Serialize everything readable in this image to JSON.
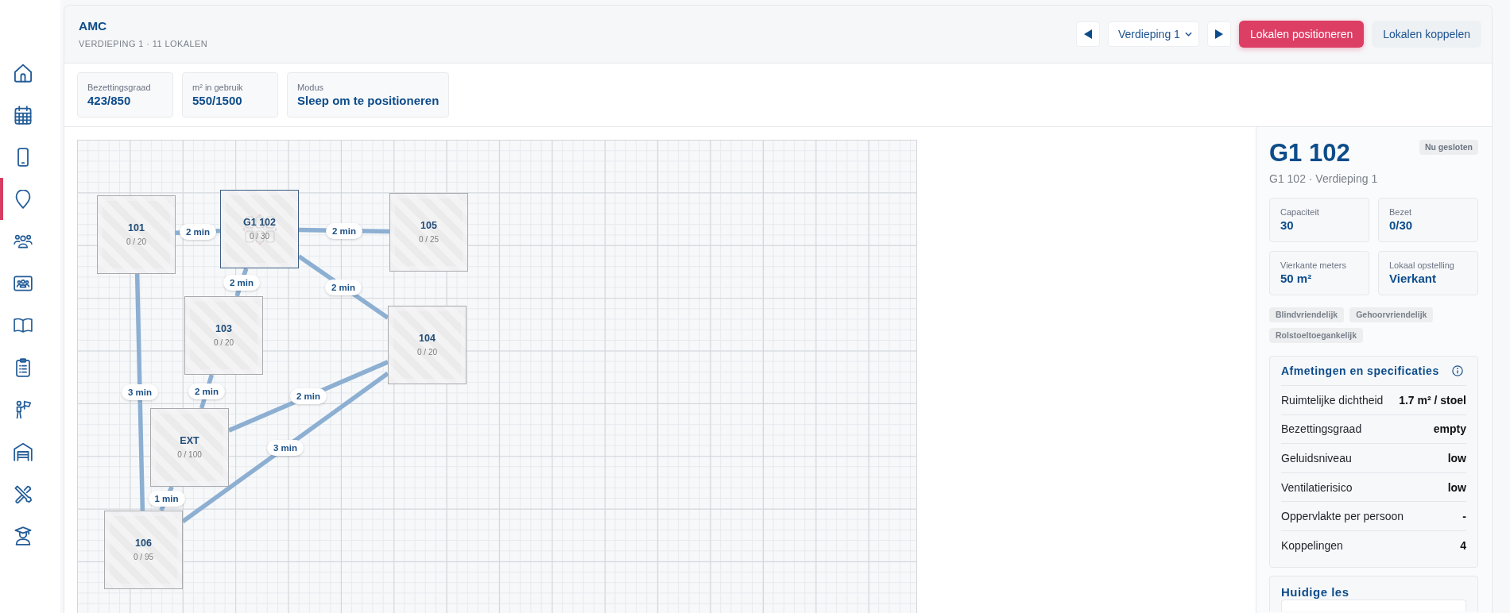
{
  "sidebar": {
    "items": [
      {
        "selected": false
      },
      {
        "selected": false
      },
      {
        "selected": false
      },
      {
        "selected": true
      },
      {
        "selected": false
      },
      {
        "selected": false
      },
      {
        "selected": false
      },
      {
        "selected": false
      },
      {
        "selected": false
      },
      {
        "selected": false
      },
      {
        "selected": false
      },
      {
        "selected": false
      }
    ]
  },
  "header": {
    "title": "AMC",
    "subtitle": "VERDIEPING 1 · 11 LOKALEN",
    "floor_select": {
      "value": "Verdieping 1"
    },
    "buttons": [
      {
        "label": "Lokalen positioneren",
        "selected": true
      },
      {
        "label": "Lokalen koppelen",
        "selected": false
      }
    ]
  },
  "stats": [
    {
      "label": "Bezettingsgraad",
      "value": "423/850"
    },
    {
      "label": "m² in gebruik",
      "value": "550/1500"
    },
    {
      "label": "Modus",
      "value": "Sleep om te positioneren"
    }
  ],
  "floor_plan": {
    "rooms": [
      {
        "name": "101",
        "occupancy": "0 / 20",
        "selected": false
      },
      {
        "name": "G1 102",
        "occupancy": "0 / 30",
        "selected": true
      },
      {
        "name": "105",
        "occupancy": "0 / 25",
        "selected": false
      },
      {
        "name": "103",
        "occupancy": "0 / 20",
        "selected": false
      },
      {
        "name": "104",
        "occupancy": "0 / 20",
        "selected": false
      },
      {
        "name": "EXT",
        "occupancy": "0 / 100",
        "selected": false
      },
      {
        "name": "106",
        "occupancy": "0 / 95",
        "selected": false
      }
    ],
    "connections": [
      {
        "label": "2 min"
      },
      {
        "label": "2 min"
      },
      {
        "label": "2 min"
      },
      {
        "label": "2 min"
      },
      {
        "label": "3 min"
      },
      {
        "label": "2 min"
      },
      {
        "label": "2 min"
      },
      {
        "label": "3 min"
      },
      {
        "label": "1 min"
      }
    ]
  },
  "details": {
    "title": "G1 102",
    "status": "Nu gesloten",
    "subtitle": "G1 102 · Verdieping 1",
    "facts": [
      {
        "label": "Capaciteit",
        "value": "30"
      },
      {
        "label": "Bezet",
        "value": "0/30"
      },
      {
        "label": "Vierkante meters",
        "value": "50 m²"
      },
      {
        "label": "Lokaal opstelling",
        "value": "Vierkant"
      }
    ],
    "tags": [
      "Blindvriendelijk",
      "Gehoorvriendelijk",
      "Rolstoeltoegankelijk"
    ],
    "specs": {
      "title": "Afmetingen en specificaties",
      "rows": [
        {
          "label": "Ruimtelijke dichtheid",
          "value": "1.7 m² / stoel"
        },
        {
          "label": "Bezettingsgraad",
          "value": "empty"
        },
        {
          "label": "Geluidsniveau",
          "value": "low"
        },
        {
          "label": "Ventilatierisico",
          "value": "low"
        },
        {
          "label": "Oppervlakte per persoon",
          "value": "-"
        },
        {
          "label": "Koppelingen",
          "value": "4"
        }
      ]
    },
    "current_lesson": {
      "title": "Huidige les"
    }
  }
}
